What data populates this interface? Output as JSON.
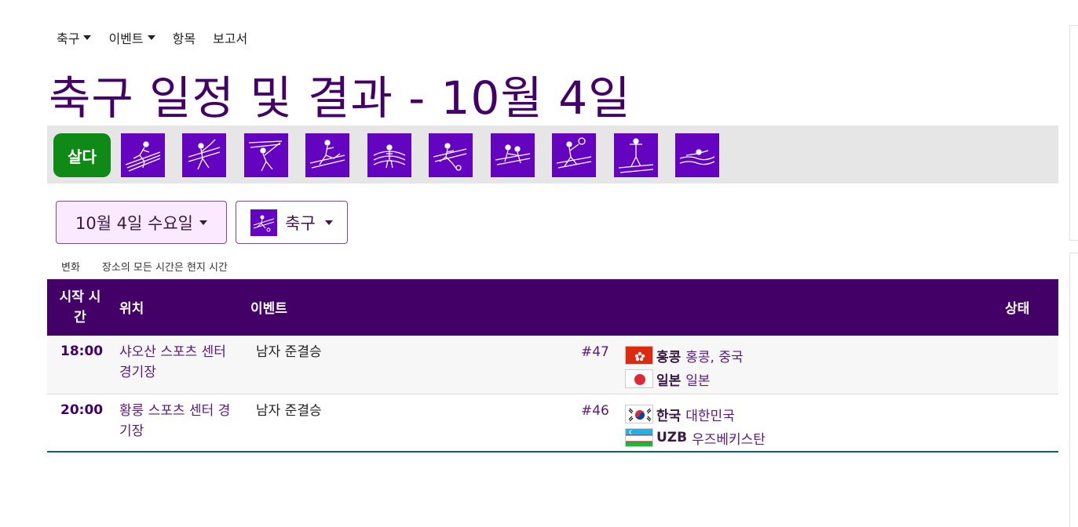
{
  "nav": {
    "items": [
      {
        "label": "축구",
        "has_dropdown": true
      },
      {
        "label": "이벤트",
        "has_dropdown": true
      },
      {
        "label": "항목",
        "has_dropdown": false
      },
      {
        "label": "보고서",
        "has_dropdown": false
      }
    ]
  },
  "page_title": "축구 일정 및 결과 - 10월 4일",
  "sport_bar": {
    "live_label": "살다",
    "sport_icons": [
      "athletics-icon",
      "badminton-icon",
      "fencing-icon",
      "taekwondo-icon",
      "weightlifting-icon",
      "football-icon",
      "wrestling-icon",
      "table-tennis-icon",
      "diving-icon",
      "swimming-icon"
    ]
  },
  "filters": {
    "date_label": "10월 4일 수요일",
    "sport_label": "축구"
  },
  "info": {
    "change_label": "변화",
    "timezone_note": "장소의 모든 시간은 현지 시간"
  },
  "table": {
    "headers": {
      "time": "시작 시간",
      "venue": "위치",
      "event": "이벤트",
      "status": "상태"
    },
    "rows": [
      {
        "time": "18:00",
        "venue": "샤오산 스포츠 센터 경기장",
        "event": "남자 준결승",
        "match_no": "#47",
        "teams": [
          {
            "code": "홍콩",
            "name": "홍콩, 중국",
            "flag": "hong-kong-flag-icon"
          },
          {
            "code": "일본",
            "name": "일본",
            "flag": "japan-flag-icon"
          }
        ]
      },
      {
        "time": "20:00",
        "venue": "황룽 스포츠 센터 경기장",
        "event": "남자 준결승",
        "match_no": "#46",
        "teams": [
          {
            "code": "한국",
            "name": "대한민국",
            "flag": "korea-flag-icon"
          },
          {
            "code": "UZB",
            "name": "우즈베키스탄",
            "flag": "uzbekistan-flag-icon"
          }
        ]
      }
    ]
  },
  "colors": {
    "brand_purple": "#430066",
    "icon_purple": "#6404c0",
    "live_green": "#108a16",
    "sport_bar_bg": "#e6e6e6"
  }
}
